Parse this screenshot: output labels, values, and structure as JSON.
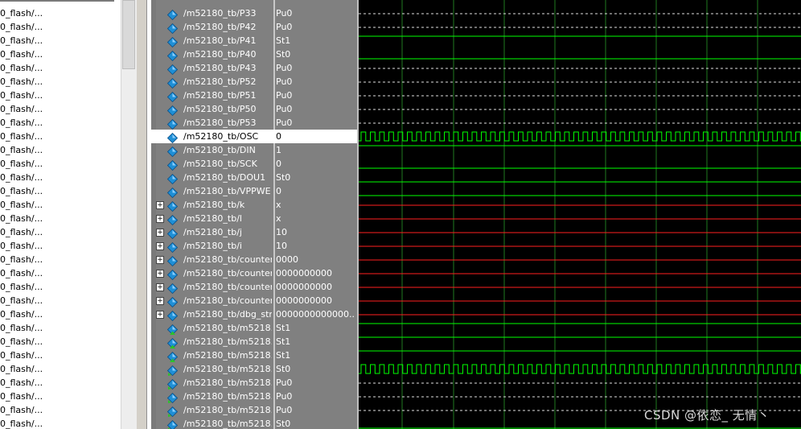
{
  "file_list": {
    "items": [
      "0_flash/...",
      "0_flash/...",
      "0_flash/...",
      "0_flash/...",
      "0_flash/...",
      "0_flash/...",
      "0_flash/...",
      "0_flash/...",
      "0_flash/...",
      "0_flash/...",
      "0_flash/...",
      "0_flash/...",
      "0_flash/...",
      "0_flash/...",
      "0_flash/...",
      "0_flash/...",
      "0_flash/...",
      "0_flash/...",
      "0_flash/...",
      "0_flash/...",
      "0_flash/...",
      "0_flash/...",
      "0_flash/...",
      "0_flash/...",
      "0_flash/...",
      "0_flash/...",
      "0_flash/...",
      "0_flash/...",
      "0_flash/...",
      "0_flash/...",
      "0_flash/..."
    ]
  },
  "signals": [
    {
      "name": "/m52180_tb/P33",
      "value": "Pu0",
      "wave": "dashed",
      "expandable": false,
      "icon": "signal-diamond-icon"
    },
    {
      "name": "/m52180_tb/P42",
      "value": "Pu0",
      "wave": "dashed",
      "expandable": false,
      "icon": "signal-diamond-icon"
    },
    {
      "name": "/m52180_tb/P41",
      "value": "St1",
      "wave": "high",
      "expandable": false,
      "icon": "signal-diamond-icon"
    },
    {
      "name": "/m52180_tb/P40",
      "value": "St0",
      "wave": "low",
      "expandable": false,
      "icon": "signal-diamond-icon"
    },
    {
      "name": "/m52180_tb/P43",
      "value": "Pu0",
      "wave": "dashed",
      "expandable": false,
      "icon": "signal-diamond-icon"
    },
    {
      "name": "/m52180_tb/P52",
      "value": "Pu0",
      "wave": "dashed",
      "expandable": false,
      "icon": "signal-diamond-icon"
    },
    {
      "name": "/m52180_tb/P51",
      "value": "Pu0",
      "wave": "dashed",
      "expandable": false,
      "icon": "signal-diamond-icon"
    },
    {
      "name": "/m52180_tb/P50",
      "value": "Pu0",
      "wave": "dashed",
      "expandable": false,
      "icon": "signal-diamond-icon"
    },
    {
      "name": "/m52180_tb/P53",
      "value": "Pu0",
      "wave": "dashed",
      "expandable": false,
      "icon": "signal-diamond-icon"
    },
    {
      "name": "/m52180_tb/OSC",
      "value": "0",
      "wave": "clock",
      "expandable": false,
      "selected": true,
      "icon": "signal-diamond-icon"
    },
    {
      "name": "/m52180_tb/DIN",
      "value": "1",
      "wave": "high",
      "expandable": false,
      "icon": "signal-diamond-icon"
    },
    {
      "name": "/m52180_tb/SCK",
      "value": "0",
      "wave": "low",
      "expandable": false,
      "icon": "signal-diamond-icon"
    },
    {
      "name": "/m52180_tb/DOU1",
      "value": "St0",
      "wave": "low",
      "expandable": false,
      "icon": "signal-diamond-icon"
    },
    {
      "name": "/m52180_tb/VPPWE",
      "value": "0",
      "wave": "low",
      "expandable": false,
      "icon": "signal-diamond-icon"
    },
    {
      "name": "/m52180_tb/k",
      "value": "x",
      "wave": "red",
      "expandable": true,
      "icon": "signal-diamond-icon"
    },
    {
      "name": "/m52180_tb/l",
      "value": "x",
      "wave": "red",
      "expandable": true,
      "icon": "signal-diamond-icon"
    },
    {
      "name": "/m52180_tb/j",
      "value": "10",
      "wave": "red",
      "expandable": true,
      "icon": "signal-diamond-icon"
    },
    {
      "name": "/m52180_tb/i",
      "value": "10",
      "wave": "red",
      "expandable": true,
      "icon": "signal-diamond-icon"
    },
    {
      "name": "/m52180_tb/counter1",
      "value": "0000",
      "wave": "red",
      "expandable": true,
      "icon": "signal-diamond-icon"
    },
    {
      "name": "/m52180_tb/counter2",
      "value": "0000000000",
      "wave": "red",
      "expandable": true,
      "icon": "signal-diamond-icon"
    },
    {
      "name": "/m52180_tb/counter5",
      "value": "0000000000",
      "wave": "red",
      "expandable": true,
      "icon": "signal-diamond-icon"
    },
    {
      "name": "/m52180_tb/counter3",
      "value": "0000000000",
      "wave": "red",
      "expandable": true,
      "icon": "signal-diamond-icon"
    },
    {
      "name": "/m52180_tb/dbg_str",
      "value": "0000000000000...",
      "wave": "red",
      "expandable": true,
      "icon": "signal-diamond-icon"
    },
    {
      "name": "/m52180_tb/m5218...",
      "value": "St1",
      "wave": "high",
      "expandable": false,
      "icon": "signal-output-icon"
    },
    {
      "name": "/m52180_tb/m5218...",
      "value": "St1",
      "wave": "high",
      "expandable": false,
      "icon": "signal-output-icon"
    },
    {
      "name": "/m52180_tb/m5218...",
      "value": "St1",
      "wave": "high",
      "expandable": false,
      "icon": "signal-output-icon"
    },
    {
      "name": "/m52180_tb/m5218...",
      "value": "St0",
      "wave": "clock",
      "expandable": false,
      "icon": "signal-inout-icon"
    },
    {
      "name": "/m52180_tb/m5218...",
      "value": "Pu0",
      "wave": "dashed",
      "expandable": false,
      "icon": "signal-inout-icon"
    },
    {
      "name": "/m52180_tb/m5218...",
      "value": "Pu0",
      "wave": "dashed",
      "expandable": false,
      "icon": "signal-inout-icon"
    },
    {
      "name": "/m52180_tb/m5218...",
      "value": "Pu0",
      "wave": "dashed",
      "expandable": false,
      "icon": "signal-inout-icon"
    },
    {
      "name": "/m52180_tb/m5218...",
      "value": "St0",
      "wave": "low",
      "expandable": false,
      "icon": "signal-inout-icon"
    }
  ],
  "colors": {
    "wave_green": "#00ff00",
    "wave_red": "#ff2020",
    "wave_dashed": "#e0e0e0",
    "grid": "#1f7a1f",
    "icon_blue": "#1e8fd6",
    "icon_green": "#2cc22c"
  },
  "watermark": "CSDN @依恋_ 无情丶"
}
